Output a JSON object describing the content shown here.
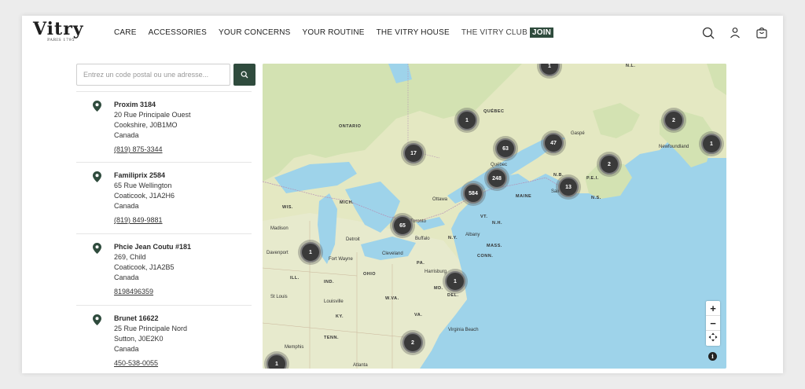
{
  "header": {
    "logo_word": "Vitry",
    "logo_sub": "PARIS 1795",
    "nav": [
      "CARE",
      "ACCESSORIES",
      "YOUR CONCERNS",
      "YOUR ROUTINE",
      "THE VITRY HOUSE",
      "THE VITRY CLUB"
    ],
    "join_label": "JOIN",
    "icons": [
      "search-icon",
      "account-icon",
      "cart-icon"
    ]
  },
  "search": {
    "placeholder": "Entrez un code postal ou une adresse..."
  },
  "stores": [
    {
      "name": "Proxim 3184",
      "street": "20 Rue Principale Ouest",
      "city": "Cookshire, J0B1MO",
      "country": "Canada",
      "phone": "(819) 875-3344"
    },
    {
      "name": "Familiprix 2584",
      "street": "65 Rue Wellington",
      "city": "Coaticook, J1A2H6",
      "country": "Canada",
      "phone": "(819) 849-9881"
    },
    {
      "name": "Phcie Jean Coutu #181",
      "street": "269, Child",
      "city": "Coaticook, J1A2B5",
      "country": "Canada",
      "phone": "8198496359"
    },
    {
      "name": "Brunet 16622",
      "street": "25 Rue Principale Nord",
      "city": "Sutton, J0E2K0",
      "country": "Canada",
      "phone": "450-538-0055"
    }
  ],
  "map": {
    "clusters": [
      "1",
      "1",
      "2",
      "1",
      "17",
      "63",
      "47",
      "2",
      "248",
      "13",
      "584",
      "65",
      "1",
      "1",
      "2",
      "1"
    ],
    "regions": [
      "ONTARIO",
      "QUÉBEC",
      "MAINE",
      "N.B.",
      "P.E.I.",
      "N.S.",
      "WIS.",
      "MICH.",
      "VT.",
      "N.H.",
      "N.Y.",
      "MASS.",
      "CONN.",
      "PA.",
      "OHIO",
      "ILL.",
      "IND.",
      "W.VA.",
      "MD.",
      "DEL.",
      "VA.",
      "KY.",
      "TENN.",
      "N.L."
    ],
    "cities": [
      "Ottawa",
      "Toronto",
      "Detroit",
      "Buffalo",
      "Albany",
      "Cleveland",
      "Fort Wayne",
      "Harrisburg",
      "Madison",
      "Davenport",
      "St Louis",
      "Louisville",
      "Memphis",
      "Virginia Beach",
      "Atlanta",
      "Newfoundland",
      "Québec",
      "Gaspé",
      "Saint"
    ],
    "zoom_in": "+",
    "zoom_out": "−",
    "info": "i"
  }
}
